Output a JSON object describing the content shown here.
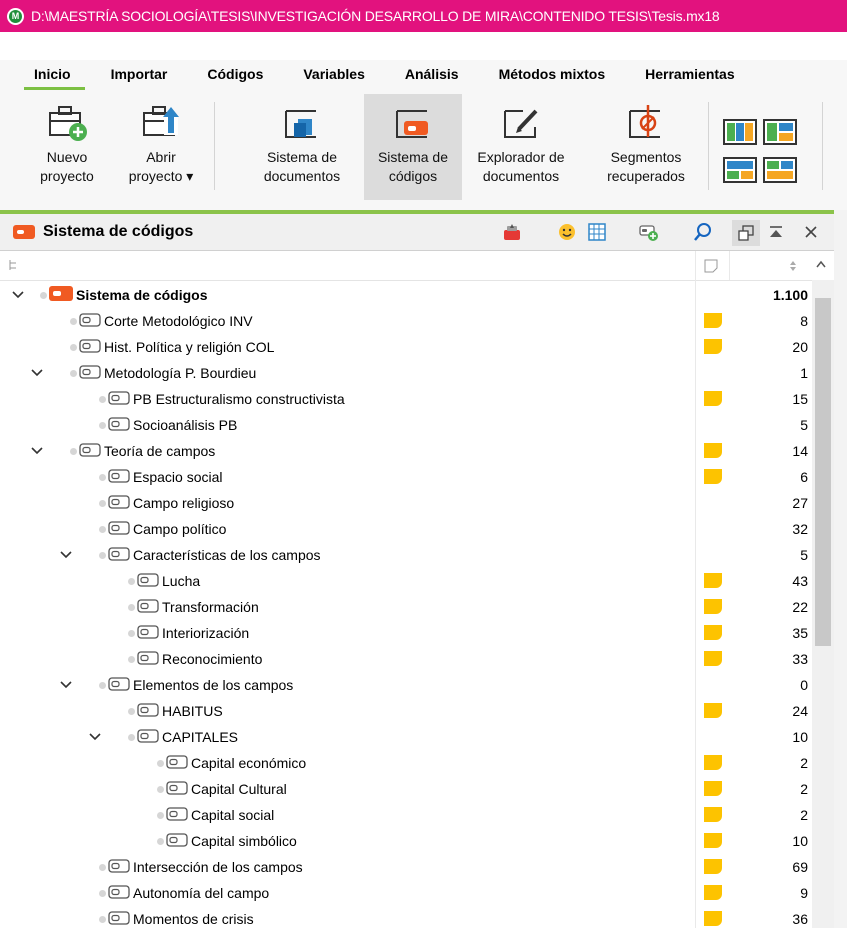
{
  "window": {
    "title": "D:\\MAESTRÍA SOCIOLOGÍA\\TESIS\\INVESTIGACIÓN DESARROLLO DE MIRA\\CONTENIDO TESIS\\Tesis.mx18"
  },
  "menu": [
    "Inicio",
    "Importar",
    "Códigos",
    "Variables",
    "Análisis",
    "Métodos mixtos",
    "Herramientas"
  ],
  "ribbon": {
    "nuevo": [
      "Nuevo",
      "proyecto"
    ],
    "abrir": [
      "Abrir",
      "proyecto ▾"
    ],
    "sis_docs": [
      "Sistema de",
      "documentos"
    ],
    "sis_codigos": [
      "Sistema de",
      "códigos"
    ],
    "explorador": [
      "Explorador de",
      "documentos"
    ],
    "segmentos": [
      "Segmentos",
      "recuperados"
    ]
  },
  "panel": {
    "title": "Sistema de códigos"
  },
  "colors": {
    "accent_green": "#8bc34a",
    "title_pink": "#e2127e",
    "memo_yellow": "#fdc300",
    "root_orange": "#f05a22"
  },
  "tree": [
    {
      "label": "Sistema de códigos",
      "count": "1.100",
      "memo": false
    },
    {
      "label": "Corte Metodológico INV",
      "count": "8",
      "memo": true
    },
    {
      "label": "Hist. Política y religión COL",
      "count": "20",
      "memo": true
    },
    {
      "label": "Metodología P. Bourdieu",
      "count": "1",
      "memo": false
    },
    {
      "label": "PB Estructuralismo constructivista",
      "count": "15",
      "memo": true
    },
    {
      "label": "Socioanálisis PB",
      "count": "5",
      "memo": false
    },
    {
      "label": "Teoría de campos",
      "count": "14",
      "memo": true
    },
    {
      "label": "Espacio social",
      "count": "6",
      "memo": true
    },
    {
      "label": "Campo religioso",
      "count": "27",
      "memo": false
    },
    {
      "label": "Campo político",
      "count": "32",
      "memo": false
    },
    {
      "label": "Características de los campos",
      "count": "5",
      "memo": false
    },
    {
      "label": "Lucha",
      "count": "43",
      "memo": true
    },
    {
      "label": "Transformación",
      "count": "22",
      "memo": true
    },
    {
      "label": "Interiorización",
      "count": "35",
      "memo": true
    },
    {
      "label": "Reconocimiento",
      "count": "33",
      "memo": true
    },
    {
      "label": "Elementos de los campos",
      "count": "0",
      "memo": false
    },
    {
      "label": "HABITUS",
      "count": "24",
      "memo": true
    },
    {
      "label": "CAPITALES",
      "count": "10",
      "memo": false
    },
    {
      "label": "Capital económico",
      "count": "2",
      "memo": true
    },
    {
      "label": "Capital Cultural",
      "count": "2",
      "memo": true
    },
    {
      "label": "Capital social",
      "count": "2",
      "memo": true
    },
    {
      "label": "Capital simbólico",
      "count": "10",
      "memo": true
    },
    {
      "label": "Intersección de los campos",
      "count": "69",
      "memo": true
    },
    {
      "label": "Autonomía del campo",
      "count": "9",
      "memo": true
    },
    {
      "label": "Momentos de crisis",
      "count": "36",
      "memo": true
    }
  ]
}
